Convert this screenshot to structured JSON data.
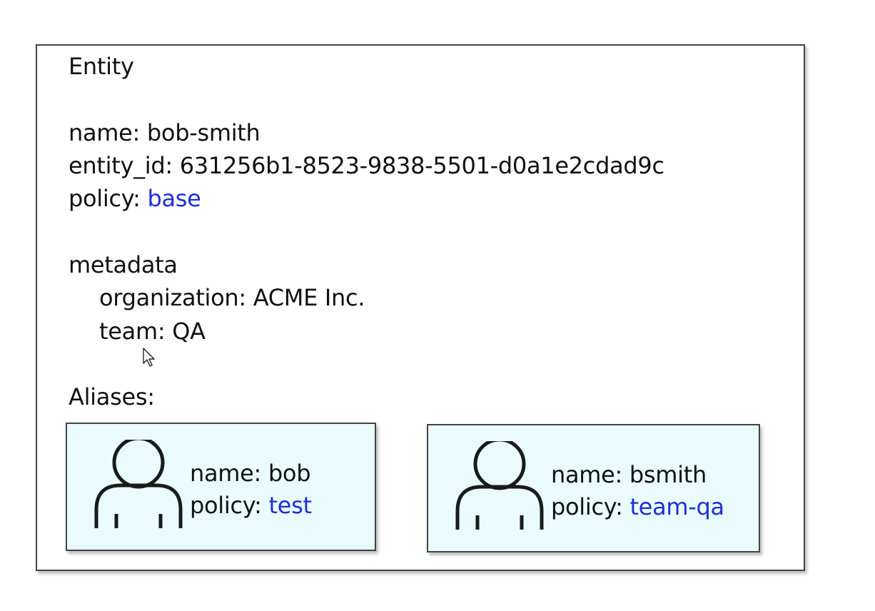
{
  "entity": {
    "title": "Entity",
    "name_label": "name:",
    "name_value": "bob-smith",
    "entity_id_label": "entity_id:",
    "entity_id_value": "631256b1-8523-9838-5501-d0a1e2cdad9c",
    "policy_label": "policy:",
    "policy_value": "base",
    "metadata_title": "metadata",
    "organization_label": "organization:",
    "organization_value": "ACME Inc.",
    "team_label": "team:",
    "team_value": "QA",
    "aliases_title": "Aliases:"
  },
  "aliases": [
    {
      "name_label": "name:",
      "name_value": "bob",
      "policy_label": "policy:",
      "policy_value": "test",
      "icon": "person-icon"
    },
    {
      "name_label": "name:",
      "name_value": "bsmith",
      "policy_label": "policy:",
      "policy_value": "team-qa",
      "icon": "person-icon"
    }
  ],
  "colors": {
    "accent_blue": "#1f2ed6",
    "alias_background": "#e9fbfd",
    "border": "#444444"
  }
}
